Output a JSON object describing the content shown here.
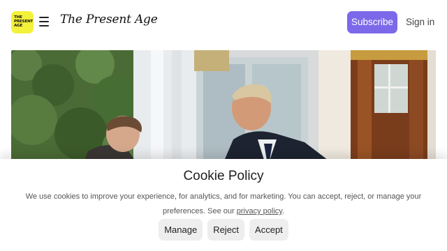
{
  "header": {
    "logo_text": "THE\nPRESENT\nAGE",
    "logo_icon": "publication-logo-icon",
    "menu_icon": "hamburger-menu-icon",
    "brand_title": "The Present Age",
    "subscribe_label": "Subscribe",
    "signin_label": "Sign in"
  },
  "hero": {
    "image_description_icon": "hero-photo"
  },
  "cookie_banner": {
    "title": "Cookie Policy",
    "text_before_link": "We use cookies to improve your experience, for analytics, and for marketing. You can accept, reject, or manage your preferences. See our ",
    "link_text": "privacy policy",
    "text_after_link": ".",
    "buttons": {
      "manage": "Manage",
      "reject": "Reject",
      "accept": "Accept"
    }
  },
  "colors": {
    "accent": "#7c69ea",
    "logo_bg": "#f4f13b",
    "button_bg": "#eeeeee"
  }
}
